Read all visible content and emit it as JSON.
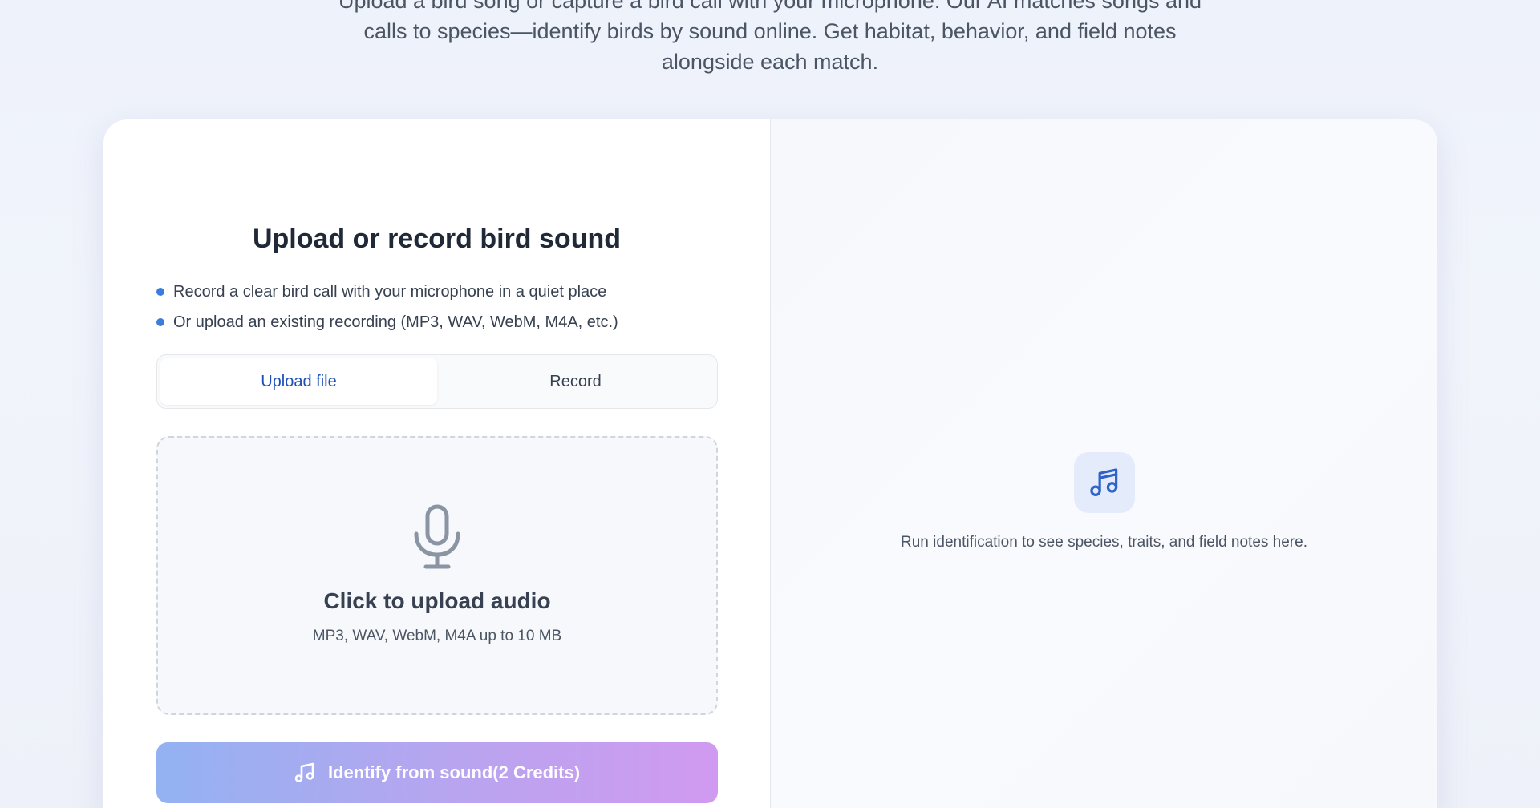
{
  "hero": {
    "description": "Upload a bird song or capture a bird call with your microphone. Our AI matches songs and calls to species—identify birds by sound online. Get habitat, behavior, and field notes alongside each match."
  },
  "upload_panel": {
    "title": "Upload or record bird sound",
    "tips": [
      "Record a clear bird call with your microphone in a quiet place",
      "Or upload an existing recording (MP3, WAV, WebM, M4A, etc.)"
    ],
    "tabs": [
      {
        "label": "Upload file",
        "active": true
      },
      {
        "label": "Record",
        "active": false
      }
    ],
    "dropzone": {
      "icon": "microphone-icon",
      "title": "Click to upload audio",
      "subtitle": "MP3, WAV, WebM, M4A up to 10 MB"
    },
    "identify_button": {
      "icon": "music-note-icon",
      "label": "Identify from sound(2 Credits)"
    }
  },
  "results_panel": {
    "icon": "music-note-icon",
    "empty_text": "Run identification to see species, traits, and field notes here."
  },
  "colors": {
    "accent": "#3b7ddd",
    "tab_active": "#1e4fb5",
    "button_gradient_start": "#93b2f2",
    "button_gradient_end": "#d09af0"
  }
}
